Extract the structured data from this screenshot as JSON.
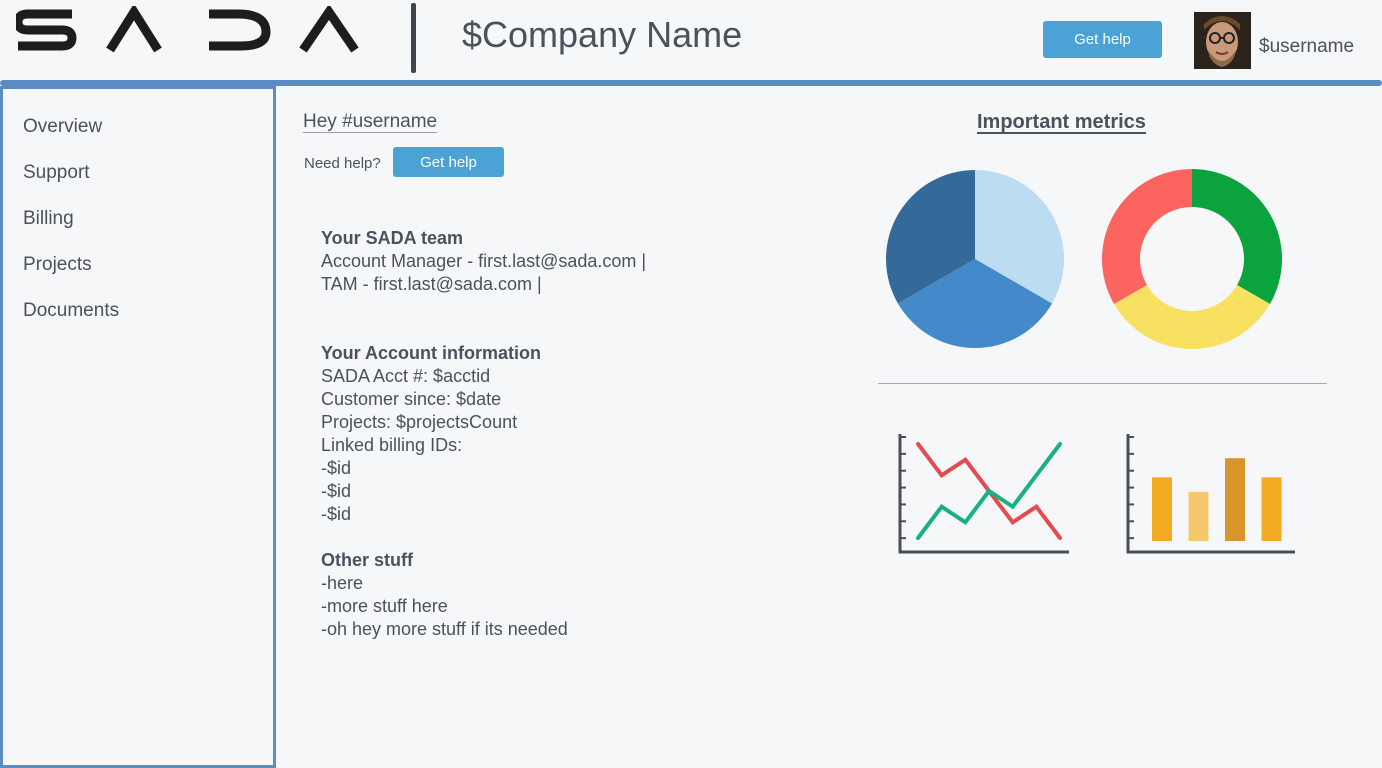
{
  "header": {
    "logo_name": "SADA",
    "company_name": "$Company Name",
    "help_label": "Get help",
    "username": "$username"
  },
  "sidebar": {
    "items": [
      {
        "label": "Overview"
      },
      {
        "label": "Support"
      },
      {
        "label": "Billing"
      },
      {
        "label": "Projects"
      },
      {
        "label": "Documents"
      }
    ]
  },
  "main": {
    "greeting": "Hey #username",
    "need_help_label": "Need help?",
    "help_label": "Get help",
    "team": {
      "heading": "Your SADA team",
      "lines": [
        "Account Manager - first.last@sada.com |",
        "TAM - first.last@sada.com |"
      ]
    },
    "account": {
      "heading": "Your Account information",
      "lines": [
        "SADA Acct #:  $acctid",
        "Customer since:  $date",
        "Projects: $projectsCount",
        "Linked billing IDs:",
        "-$id",
        "-$id",
        "-$id"
      ]
    },
    "other": {
      "heading": "Other stuff",
      "lines": [
        "-here",
        "-more stuff here",
        "-oh hey more stuff if its needed"
      ]
    }
  },
  "metrics": {
    "title": "Important metrics"
  },
  "colors": {
    "accent": "#5b8cc5",
    "button": "#4aa3d4",
    "text": "#4a525c"
  },
  "chart_data": [
    {
      "type": "pie",
      "values": [
        1,
        1,
        1
      ],
      "colors": [
        "#bcdcf2",
        "#448acb",
        "#336a99"
      ]
    },
    {
      "type": "pie",
      "donut": true,
      "values": [
        1,
        1,
        1
      ],
      "colors": [
        "#0ba33d",
        "#f8e060",
        "#fc6460"
      ]
    },
    {
      "type": "line",
      "x": [
        0,
        1,
        2,
        3,
        4,
        5,
        6
      ],
      "series": [
        {
          "values": [
            6,
            4,
            5,
            3,
            1,
            2,
            0
          ],
          "color": "#e34b4e"
        },
        {
          "values": [
            0,
            2,
            1,
            3,
            2,
            4,
            6
          ],
          "color": "#18b084"
        }
      ],
      "ylim": [
        0,
        6
      ]
    },
    {
      "type": "bar",
      "values": [
        70,
        54,
        91,
        70
      ],
      "colors": [
        "#f4ab24",
        "#f6c86e",
        "#d9952b",
        "#f4ab24"
      ],
      "ylim": [
        0,
        100
      ]
    }
  ]
}
